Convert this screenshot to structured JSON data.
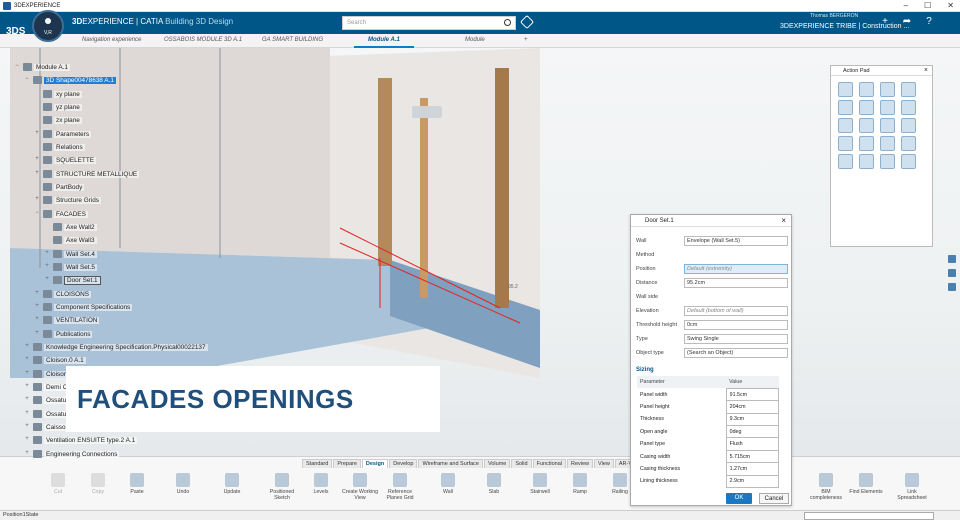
{
  "window": {
    "title": "3DEXPERIENCE",
    "controls": [
      "–",
      "☐",
      "✕"
    ]
  },
  "topbar": {
    "logo": "3DS",
    "brand_bold": "3D",
    "brand_rest": "EXPERIENCE | CATIA",
    "app_name": "Building 3D Design",
    "compass_label": "V,R",
    "search_placeholder": "Search",
    "user_name": "Thomas BERGERON",
    "tribe": "3DEXPERIENCE TRIBE | Construction ...",
    "colors": {
      "topbar": "#005686",
      "accent": "#1d7fd6"
    }
  },
  "tabs": [
    {
      "label": "Navigation experience"
    },
    {
      "label": "OSSABOIS MODULE 3D A.1"
    },
    {
      "label": "GA SMART BUILDING"
    },
    {
      "label": "Module A.1",
      "active": true
    },
    {
      "label": "Module"
    },
    {
      "label": "+"
    }
  ],
  "tree": {
    "nodes": [
      {
        "label": "Module A.1"
      },
      {
        "label": "3D Shape00478638 A.1",
        "selected": true
      },
      {
        "label": "xy plane"
      },
      {
        "label": "yz plane"
      },
      {
        "label": "zx plane"
      },
      {
        "label": "Parameters"
      },
      {
        "label": "Relations"
      },
      {
        "label": "SQUELETTE"
      },
      {
        "label": "STRUCTURE METALLIQUE"
      },
      {
        "label": "PartBody"
      },
      {
        "label": "Structure Grids"
      },
      {
        "label": "FACADES"
      },
      {
        "label": "Axe Wall2"
      },
      {
        "label": "Axe Wall3"
      },
      {
        "label": "Wall Set.4"
      },
      {
        "label": "Wall Set.5"
      },
      {
        "label": "Door Set.1",
        "boxed": true
      },
      {
        "label": "CLOISONS"
      },
      {
        "label": "Component Specifications"
      },
      {
        "label": "VENTILATION"
      },
      {
        "label": "Publications"
      },
      {
        "label": "Knowledge Engineering Specification.Physical00022137"
      },
      {
        "label": "Cloison.0 A.1"
      },
      {
        "label": "Cloison.1"
      },
      {
        "label": "Demi C..."
      },
      {
        "label": "Ossatu..."
      },
      {
        "label": "Ossatu..."
      },
      {
        "label": "Caisso..."
      },
      {
        "label": "Ventilation ENSUITE type.2 A.1"
      },
      {
        "label": "Engineering Connections"
      }
    ]
  },
  "overlay": {
    "facades_title": "FACADES OPENINGS"
  },
  "actionpad": {
    "title": "Action Pad"
  },
  "doorpanel": {
    "title": "Door Set.1",
    "rows": [
      {
        "label": "Wall",
        "value": "Envelope (Wall Set.5)"
      },
      {
        "label": "Method",
        "value": ""
      },
      {
        "label": "Position",
        "value": "Default (extremity)"
      },
      {
        "label": "Distance",
        "value": "95.2cm"
      },
      {
        "label": "Wall side",
        "value": ""
      },
      {
        "label": "Elevation",
        "value": "Default (bottom of wall)"
      },
      {
        "label": "Threshold height",
        "value": "0cm"
      },
      {
        "label": "Type",
        "value": "Swing Single"
      },
      {
        "label": "Object type",
        "value": "(Search an Object)"
      }
    ],
    "sizing_label": "Sizing",
    "sizing_headers": [
      "Parameter",
      "Value"
    ],
    "sizing": [
      {
        "p": "Panel width",
        "v": "91.5cm"
      },
      {
        "p": "Panel height",
        "v": "204cm"
      },
      {
        "p": "Thickness",
        "v": "9.3cm"
      },
      {
        "p": "Open angle",
        "v": "0deg"
      },
      {
        "p": "Panel type",
        "v": "Flush"
      },
      {
        "p": "Casing width",
        "v": "5.715cm"
      },
      {
        "p": "Casing thickness",
        "v": "1.27cm"
      },
      {
        "p": "Lining thickness",
        "v": "2.9cm"
      }
    ],
    "ok": "OK",
    "cancel": "Cancel"
  },
  "toolbar": {
    "tabs": [
      "Standard",
      "Prepare",
      "Design",
      "Develop",
      "Wireframe and Surface",
      "Volume",
      "Solid",
      "Functional",
      "Review",
      "View",
      "AR-VR"
    ],
    "active_tab": "Design",
    "tools": [
      {
        "label": "Cut",
        "disabled": true
      },
      {
        "label": "Copy",
        "disabled": true
      },
      {
        "label": "Paste"
      },
      {
        "label": "Undo"
      },
      {
        "label": "Update"
      },
      {
        "label": "Positioned Sketch"
      },
      {
        "label": "Levels"
      },
      {
        "label": "Create Working View"
      },
      {
        "label": "Reference Planes Grid"
      },
      {
        "label": "Wall"
      },
      {
        "label": "Slab"
      },
      {
        "label": "Stairwell"
      },
      {
        "label": "Ramp"
      },
      {
        "label": "Railing"
      },
      {
        "label": "BIM completeness"
      },
      {
        "label": "Find Elements"
      },
      {
        "label": "Link Spreadsheet"
      }
    ]
  },
  "statusbar": {
    "text": "Position1State"
  },
  "viewport_labels": {
    "dim": "95.2"
  }
}
